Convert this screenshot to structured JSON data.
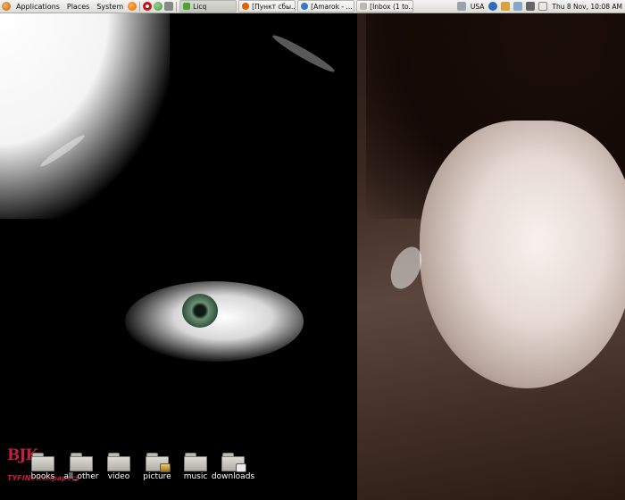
{
  "panel": {
    "menus": [
      "Applications",
      "Places",
      "System"
    ],
    "launchers": [
      {
        "icon": "firefox-icon",
        "color": "#e66000"
      },
      {
        "icon": "opera-icon",
        "color": "#cc0f16"
      },
      {
        "icon": "update-icon",
        "color": "#3a9a3a"
      },
      {
        "icon": "network-icon",
        "color": "#888888"
      }
    ],
    "tasks": [
      {
        "label": "Licq",
        "icon": "licq-icon",
        "color": "#4aa32a"
      },
      {
        "label": "[Пункт сбы...",
        "icon": "firefox-icon",
        "color": "#e66000"
      },
      {
        "label": "[Amarok - ...",
        "icon": "amarok-icon",
        "color": "#3a78c8"
      },
      {
        "label": "[Inbox (1 to...",
        "icon": "mail-icon",
        "color": "#b8b8b0"
      }
    ],
    "tray": {
      "keyboard_layout": "USA",
      "icons": [
        "workspace-icon",
        "network-icon",
        "folder-icon",
        "mail-icon",
        "volume-icon",
        "notes-icon"
      ],
      "clock": "Thu  8 Nov, 10:08 AM"
    }
  },
  "wallpaper": {
    "logo_text": "BJK",
    "logo_sub": "TYFINewallpapers"
  },
  "desktop_icons": [
    {
      "label": "books",
      "emblem": ""
    },
    {
      "label": "all_other",
      "emblem": ""
    },
    {
      "label": "video",
      "emblem": ""
    },
    {
      "label": "picture",
      "emblem": "picture"
    },
    {
      "label": "music",
      "emblem": ""
    },
    {
      "label": "downloads",
      "emblem": "downloads"
    }
  ]
}
